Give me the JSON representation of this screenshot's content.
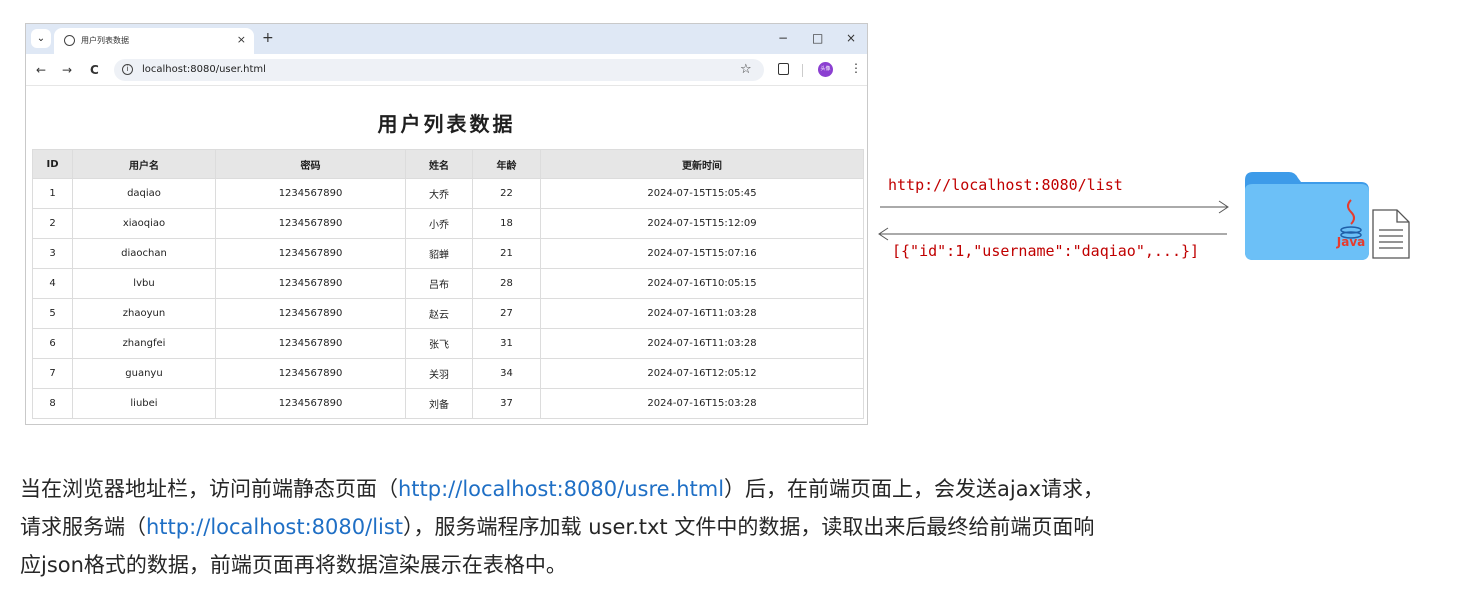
{
  "browser": {
    "tab_title": "用户列表数据",
    "tab_close": "×",
    "tab_new": "+",
    "minimize": "−",
    "maximize": "□",
    "close": "×",
    "back": "←",
    "forward": "→",
    "reload": "C",
    "url": "localhost:8080/user.html",
    "star": "☆",
    "avatar_text": "头像",
    "menu": "⋮"
  },
  "page": {
    "title": "用户列表数据",
    "columns": [
      "ID",
      "用户名",
      "密码",
      "姓名",
      "年龄",
      "更新时间"
    ],
    "rows": [
      [
        "1",
        "daqiao",
        "1234567890",
        "大乔",
        "22",
        "2024-07-15T15:05:45"
      ],
      [
        "2",
        "xiaoqiao",
        "1234567890",
        "小乔",
        "18",
        "2024-07-15T15:12:09"
      ],
      [
        "3",
        "diaochan",
        "1234567890",
        "貂蝉",
        "21",
        "2024-07-15T15:07:16"
      ],
      [
        "4",
        "lvbu",
        "1234567890",
        "吕布",
        "28",
        "2024-07-16T10:05:15"
      ],
      [
        "5",
        "zhaoyun",
        "1234567890",
        "赵云",
        "27",
        "2024-07-16T11:03:28"
      ],
      [
        "6",
        "zhangfei",
        "1234567890",
        "张飞",
        "31",
        "2024-07-16T11:03:28"
      ],
      [
        "7",
        "guanyu",
        "1234567890",
        "关羽",
        "34",
        "2024-07-16T12:05:12"
      ],
      [
        "8",
        "liubei",
        "1234567890",
        "刘备",
        "37",
        "2024-07-16T15:03:28"
      ]
    ]
  },
  "diagram": {
    "request_url": "http://localhost:8080/list",
    "response_json": "[{\"id\":1,\"username\":\"daqiao\",...}]",
    "java_label": "Java",
    "folder_color": "#4aa8f0",
    "arrow_color": "#555555",
    "label_color": "#c00000"
  },
  "paragraph": {
    "p1": "当在浏览器地址栏，访问前端静态页面（",
    "link1": "http://localhost:8080/usre.html",
    "p2": "）后，在前端页面上，会发送ajax请求，",
    "p3": "请求服务端（",
    "link2": "http://localhost:8080/list",
    "p4": "），服务端程序加载 user.txt 文件中的数据，读取出来后最终给前端页面响",
    "p5": "应json格式的数据，前端页面再将数据渲染展示在表格中。"
  }
}
